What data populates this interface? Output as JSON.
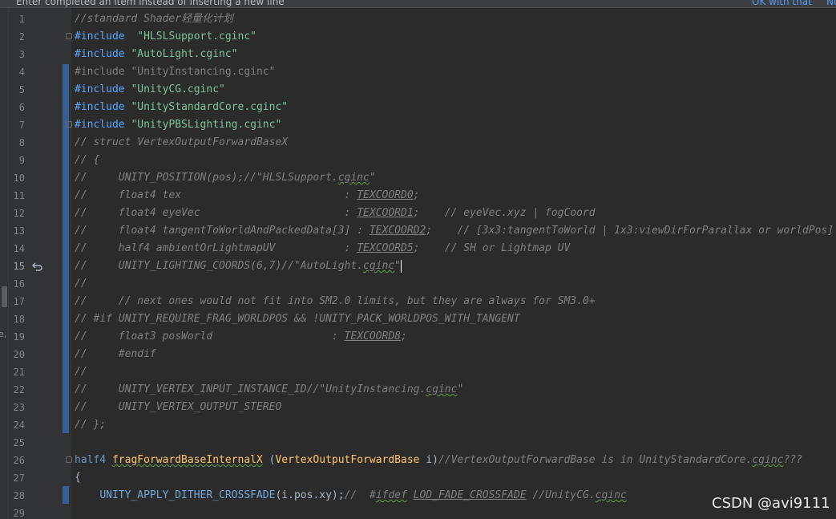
{
  "hint_bar": {
    "text": "Enter completed an item instead of inserting a new line",
    "ok_link": "OK with that",
    "no_link": "No"
  },
  "gutter": {
    "line_numbers": [
      "1",
      "2",
      "3",
      "4",
      "5",
      "6",
      "7",
      "8",
      "9",
      "10",
      "11",
      "12",
      "13",
      "14",
      "15",
      "16",
      "17",
      "18",
      "19",
      "20",
      "21",
      "22",
      "23",
      "24",
      "25",
      "26",
      "27",
      "28",
      "29"
    ],
    "current_line": "15"
  },
  "left_strip": {
    "clipped_char": "e,"
  },
  "code": {
    "l1": "//standard Shader轻量化计划",
    "l2_kw": "#include",
    "l2_str": "  \"HLSLSupport.cginc\"",
    "l3_kw": "#include",
    "l3_str": " \"AutoLight.cginc\"",
    "l4": "#include \"UnityInstancing.cginc\"",
    "l5_kw": "#include",
    "l5_str": " \"UnityCG.cginc\"",
    "l6_kw": "#include",
    "l6_str": " \"UnityStandardCore.cginc\"",
    "l7_kw": "#include",
    "l7_str": " \"UnityPBSLighting.cginc\"",
    "l8": "// struct VertexOutputForwardBaseX",
    "l9": "// {",
    "l10_a": "//     UNITY_POSITION(pos);//\"HLSLSupport.",
    "l10_b": "cginc",
    "l10_c": "\"",
    "l11_a": "//     float4 tex                          : ",
    "l11_b": "TEXCOORD0",
    "l11_c": ";",
    "l12_a": "//     float4 eyeVec                       : ",
    "l12_b": "TEXCOORD1",
    "l12_c": ";    // eyeVec.xyz | fogCoord",
    "l13_a": "//     float4 tangentToWorldAndPackedData[3] : ",
    "l13_b": "TEXCOORD2",
    "l13_c": ";    // [3x3:tangentToWorld | 1x3:viewDirForParallax or worldPos]",
    "l14_a": "//     half4 ambientOrLightmapUV           : ",
    "l14_b": "TEXCOORD5",
    "l14_c": ";    // SH or Lightmap UV",
    "l15_a": "//     UNITY_LIGHTING_COORDS(6,7)//\"AutoLight.",
    "l15_b": "cginc",
    "l15_c": "\"",
    "l16": "//",
    "l17": "//     // next ones would not fit into SM2.0 limits, but they are always for SM3.0+",
    "l18": "// #if UNITY_REQUIRE_FRAG_WORLDPOS && !UNITY_PACK_WORLDPOS_WITH_TANGENT",
    "l19_a": "//     float3 posWorld                   : ",
    "l19_b": "TEXCOORD8",
    "l19_c": ";",
    "l20": "//     #endif",
    "l21": "//",
    "l22_a": "//     UNITY_VERTEX_INPUT_INSTANCE_ID//\"UnityInstancing.",
    "l22_b": "cginc",
    "l22_c": "\"",
    "l23": "//     UNITY_VERTEX_OUTPUT_STEREO",
    "l24": "// };",
    "l25": "",
    "l26_type": "half4",
    "l26_fn": "fragForwardBaseInternalX",
    "l26_param_type": "VertexOutputForwardBase",
    "l26_param": " i)",
    "l26_com_a": "//VertexOutputForwardBase is in UnityStandardCore.",
    "l26_com_b": "cginc",
    "l26_com_c": "???",
    "l27": "{",
    "l28_macro": "UNITY_APPLY_DITHER_CROSSFADE",
    "l28_args": "(i.pos.xy);",
    "l28_com_a": "//  #",
    "l28_com_b": "ifdef",
    "l28_com_c": " ",
    "l28_com_d": "LOD_FADE_CROSSFADE",
    "l28_com_e": " //UnityCG.",
    "l28_com_f": "cginc",
    "l29": ""
  },
  "watermark": "CSDN @avi9111",
  "colors": {
    "background": "#2b2b2b",
    "gutter": "#313335",
    "keyword": "#59a7ff",
    "string": "#7ec699",
    "comment": "#808080",
    "vcs_bar": "#375f96"
  },
  "icons": [
    "undo-icon",
    "fold-marker-icon"
  ]
}
